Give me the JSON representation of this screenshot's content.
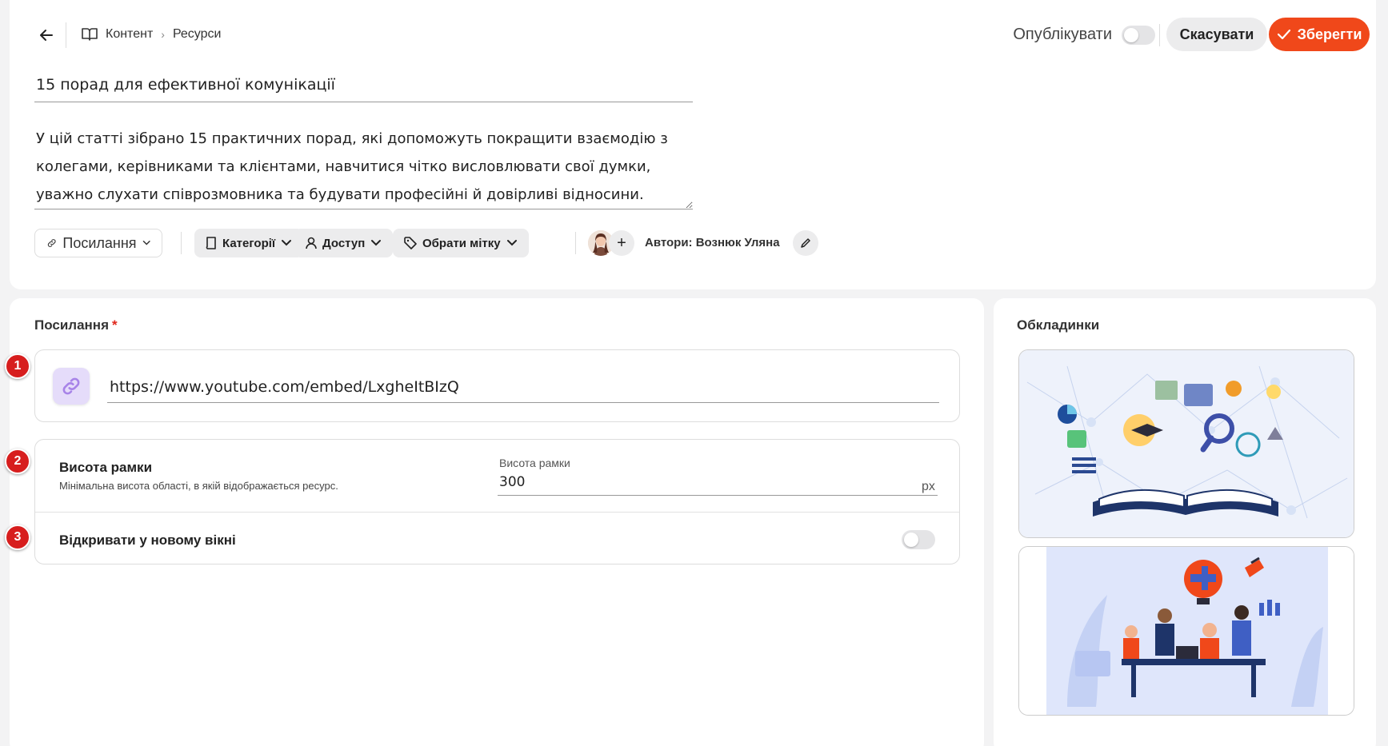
{
  "header": {
    "breadcrumbs": [
      "Контент",
      "Ресурси"
    ],
    "publish_label": "Опублікувати",
    "cancel_label": "Скасувати",
    "save_label": "Зберегти"
  },
  "article": {
    "title": "15 порад для ефективної комунікації",
    "description": "У цій статті зібрано 15 практичних порад, які допоможуть покращити взаємодію з колегами, керівниками та клієнтами, навчитися чітко висловлювати свої думки, уважно слухати співрозмовника та будувати професійні й довірливі відносини."
  },
  "toolbar": {
    "type_label": "Посилання",
    "categories_label": "Категорії",
    "access_label": "Доступ",
    "tag_label": "Обрати мітку",
    "authors_label": "Автори: Вознюк Уляна"
  },
  "link_section": {
    "title": "Посилання",
    "required_mark": "*",
    "url": "https://www.youtube.com/embed/LxgheItBIzQ"
  },
  "frame": {
    "title": "Висота рамки",
    "subtitle": "Мінімальна висота області, в якій відображається ресурс.",
    "field_label": "Висота рамки",
    "value": "300",
    "unit": "px"
  },
  "new_window": {
    "label": "Відкривати у новому вікні",
    "enabled": false
  },
  "publish_enabled": false,
  "covers": {
    "title": "Обкладинки"
  },
  "markers": [
    "1",
    "2",
    "3"
  ],
  "colors": {
    "accent": "#f0481a",
    "marker": "#d71e1e",
    "link_icon_bg": "#e5dcfa"
  }
}
